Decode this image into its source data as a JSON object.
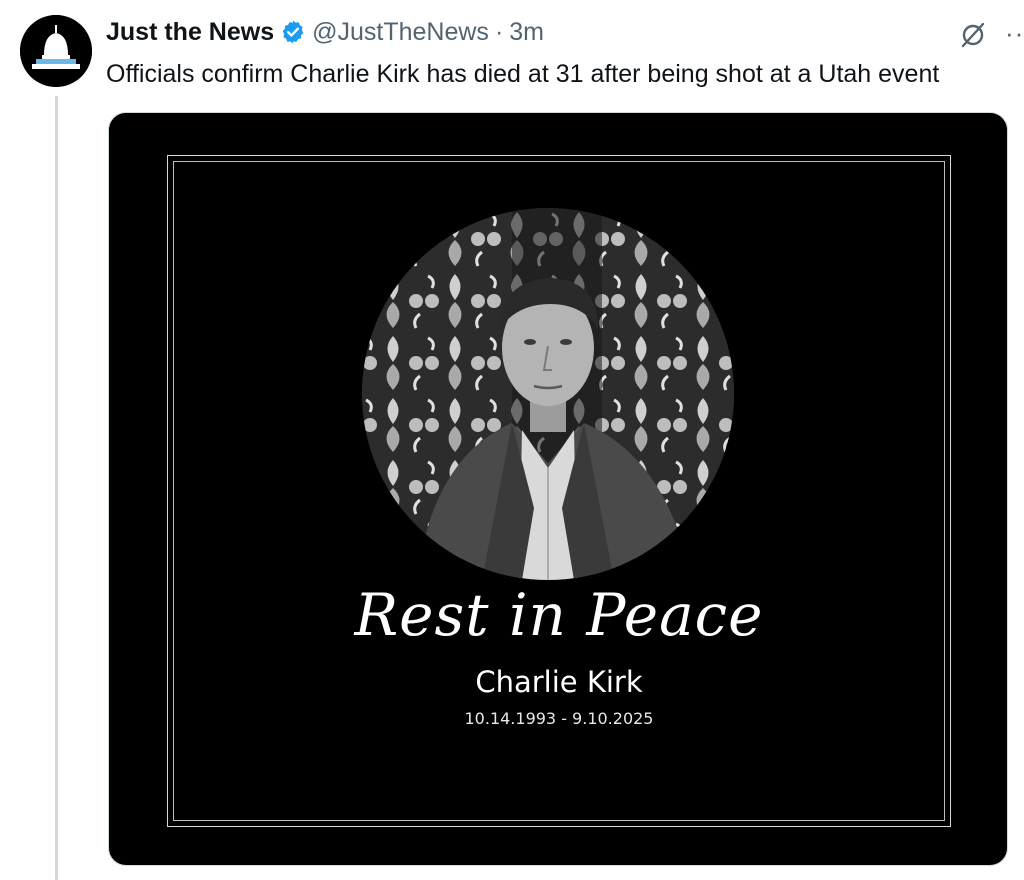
{
  "tweet": {
    "author": {
      "name": "Just the News",
      "handle": "@JustTheNews",
      "verified": true,
      "avatar_icon": "capitol-dome-icon"
    },
    "separator": "·",
    "time": "3m",
    "text": "Officials confirm Charlie Kirk has died at 31 after being shot at a Utah event",
    "actions": {
      "grok_icon": "grok-icon",
      "more_icon": "more-icon",
      "more_label": "··"
    }
  },
  "media": {
    "title": "Rest in Peace",
    "name": "Charlie Kirk",
    "dates": "10.14.1993 - 9.10.2025"
  },
  "colors": {
    "verified_blue": "#1d9bf0",
    "text_primary": "#0f1419",
    "text_secondary": "#536471",
    "thread_line": "#cfd9de",
    "media_bg": "#000000"
  }
}
